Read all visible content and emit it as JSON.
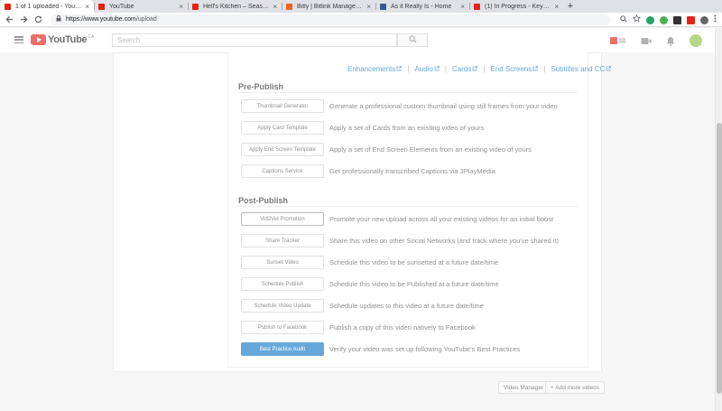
{
  "browser": {
    "tabs": [
      {
        "title": "1 of 1 uploaded - YouTube",
        "active": true,
        "favicon_color": "#e62117"
      },
      {
        "title": "YouTube",
        "active": false,
        "favicon_color": "#e62117"
      },
      {
        "title": "Hell's Kitchen – Season 1...",
        "active": false,
        "favicon_color": "#e62117"
      },
      {
        "title": "Bitly | Bitlink Managemen...",
        "active": false,
        "favicon_color": "#ee6123"
      },
      {
        "title": "As it Really Is - Home",
        "active": false,
        "favicon_color": "#3b5998"
      },
      {
        "title": "(1) In Progress - Keyword...",
        "active": false,
        "favicon_color": "#e62117"
      }
    ],
    "close_glyph": "×",
    "newtab_glyph": "+",
    "url_host": "https://www.youtube.com",
    "url_path": "/upload"
  },
  "youtube": {
    "logo_text": "YouTube",
    "logo_suffix": "CA",
    "search_placeholder": "Search"
  },
  "tools": {
    "tabs": [
      "Enhancements",
      "Audio",
      "Cards",
      "End Screens",
      "Subtitles and CC"
    ],
    "link_color": "#167ac6"
  },
  "pre_publish": {
    "title": "Pre-Publish",
    "rows": [
      {
        "button": "Thumbnail Generator",
        "desc": "Generate a professional custom thumbnail using still frames from your video"
      },
      {
        "button": "Apply Card Template",
        "desc": "Apply a set of Cards from an existing video of yours"
      },
      {
        "button": "Apply End Screen Template",
        "desc": "Apply a set of End Screen Elements from an existing video of yours"
      },
      {
        "button": "Captions Service",
        "desc": "Get professionally transcribed Captions via 3PlayMedia"
      }
    ]
  },
  "post_publish": {
    "title": "Post-Publish",
    "rows": [
      {
        "button": "Vid2Vid Promotion",
        "desc": "Promote your new upload across all your existing videos for an initial boost",
        "style": "outline"
      },
      {
        "button": "Share Tracker",
        "desc": "Share this video on other Social Networks (and track where you've shared it)",
        "style": "default"
      },
      {
        "button": "Sunset Video",
        "desc": "Schedule this video to be sunsetted at a future date/time",
        "style": "default"
      },
      {
        "button": "Schedule Publish",
        "desc": "Schedule this video to be Published at a future date/time",
        "style": "default"
      },
      {
        "button": "Schedule Video Update",
        "desc": "Schedule updates to this video at a future date/time",
        "style": "default"
      },
      {
        "button": "Publish to Facebook",
        "desc": "Publish a copy of this video natively to Facebook",
        "style": "default"
      },
      {
        "button": "Best Practice Audit",
        "desc": "Verify your video was set up following YouTube's Best Practices",
        "style": "primary"
      }
    ]
  },
  "footer": {
    "video_manager": "Video Manager",
    "add_more": "+ Add more videos"
  }
}
